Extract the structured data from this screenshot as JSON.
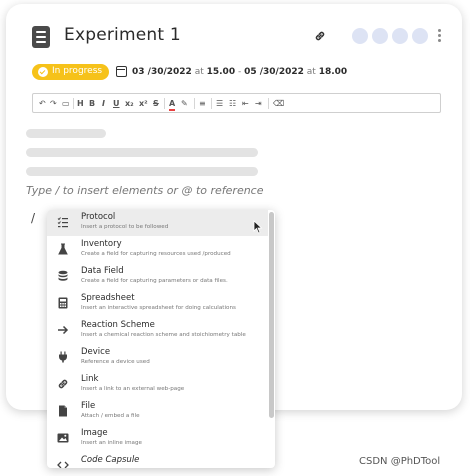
{
  "experiment": {
    "title": "Experiment 1",
    "status": "In progress",
    "date_start": "03 /30/2022",
    "at1": "at",
    "time_start": "15.00",
    "dash": "-",
    "date_end": "05 /30/2022",
    "at2": "at",
    "time_end": "18.00"
  },
  "toolbar": {
    "undo": "↶",
    "redo": "↷",
    "code": "▭",
    "heading": "H",
    "bold": "B",
    "italic": "I",
    "underline": "U",
    "subscript": "x₂",
    "superscript": "x²",
    "strike": "S",
    "text_color": "A",
    "highlight": "✎",
    "align": "≡",
    "bullets": "☰",
    "numbered": "☷",
    "outdent": "⇤",
    "indent": "⇥",
    "clear": "⌫"
  },
  "editor": {
    "hint": "Type / to insert elements or @ to reference",
    "slash": "/"
  },
  "menu": {
    "items": [
      {
        "title": "Protocol",
        "desc": "Insert a protocol to be followed"
      },
      {
        "title": "Inventory",
        "desc": "Create a field for capturing resources used /produced"
      },
      {
        "title": "Data Field",
        "desc": "Create a field for capturing parameters or data files."
      },
      {
        "title": "Spreadsheet",
        "desc": "Insert an interactive spreadsheet for doing calculations"
      },
      {
        "title": "Reaction Scheme",
        "desc": "Insert a chemical reaction scheme and stoichiometry table"
      },
      {
        "title": "Device",
        "desc": "Reference a device used"
      },
      {
        "title": "Link",
        "desc": "Insert a link to an external web-page"
      },
      {
        "title": "File",
        "desc": "Attach / embed a file"
      },
      {
        "title": "Image",
        "desc": "Insert an inline image"
      },
      {
        "title": "Code Capsule",
        "desc": ""
      }
    ]
  },
  "watermark": "CSDN @PhDTool",
  "colors": {
    "status": "#f6c21a",
    "avatar": "#dde3f4",
    "active_row": "#ececec"
  }
}
